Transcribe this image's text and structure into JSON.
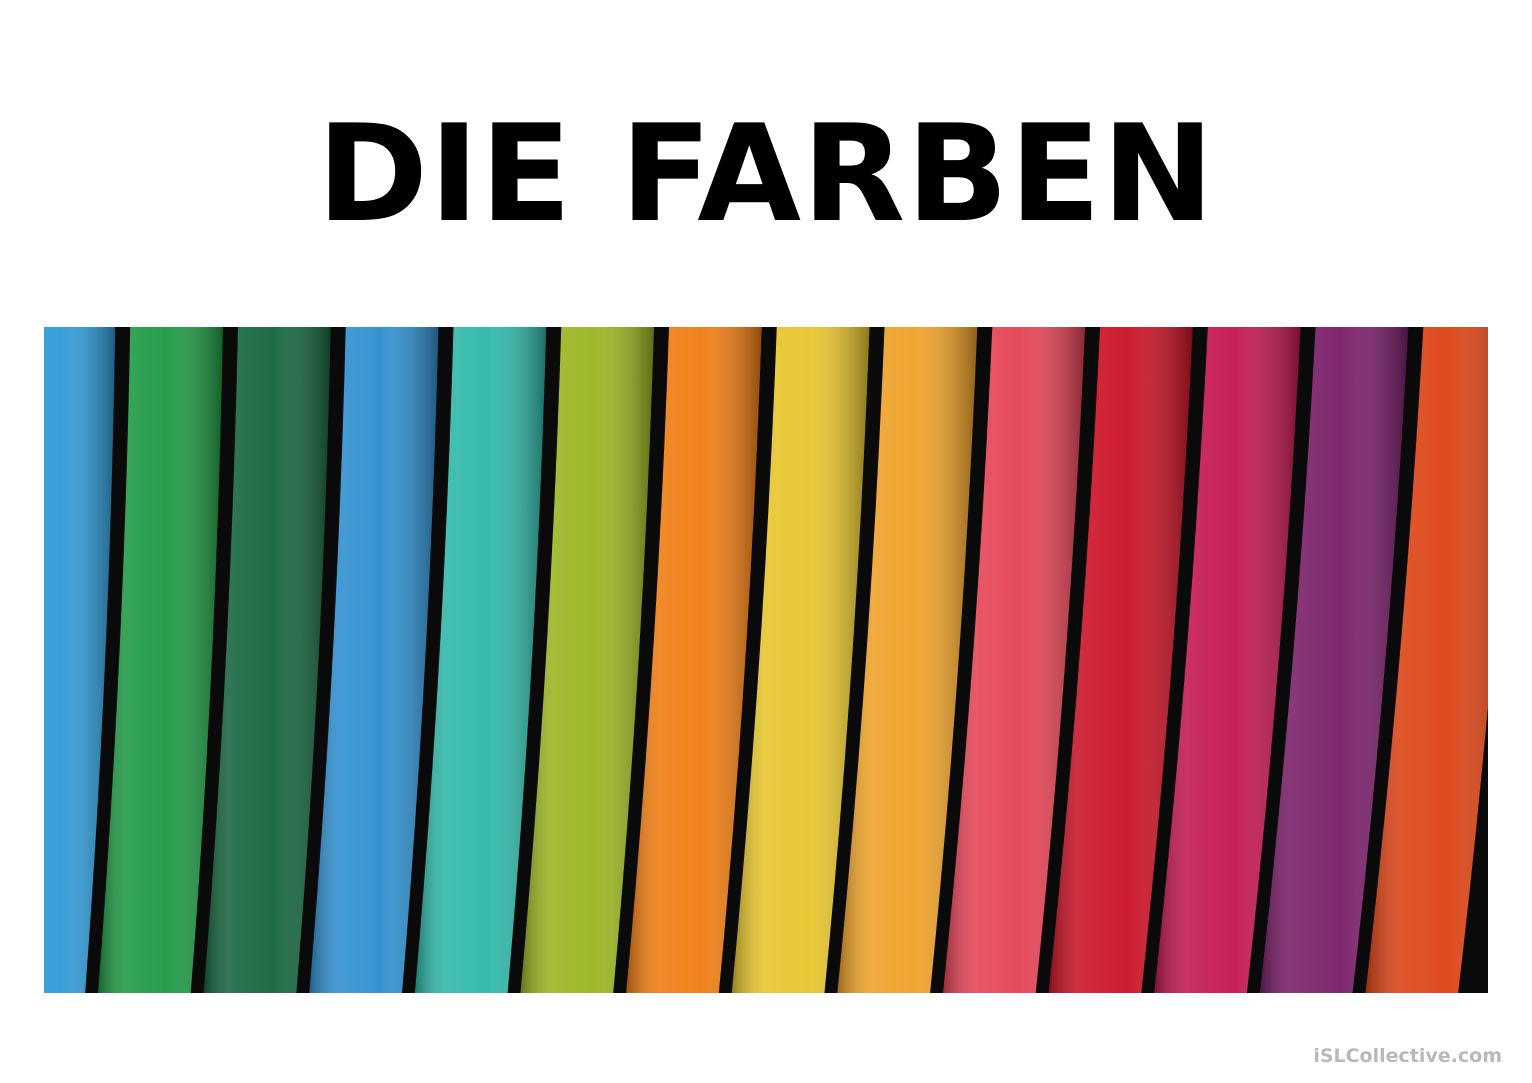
{
  "slide": {
    "title": "DIE FARBEN"
  },
  "photo": {
    "subject": "colored-pencils",
    "pencil_colors": [
      "#2f9bd8",
      "#1f9a45",
      "#16663f",
      "#2f8fcf",
      "#2fb8a8",
      "#9ab521",
      "#ef7d12",
      "#e7c52c",
      "#eea129",
      "#e64456",
      "#cc1327",
      "#c41852",
      "#7b1f6a",
      "#dd4416"
    ]
  },
  "footer": {
    "watermark": "iSLCollective.com"
  }
}
